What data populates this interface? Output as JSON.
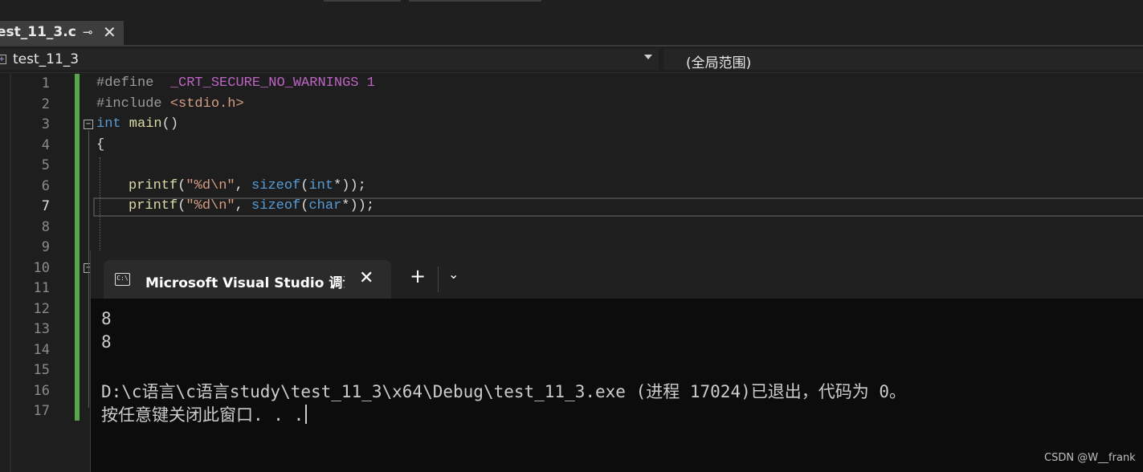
{
  "tab": {
    "file_name": "est_11_3.c",
    "pin_glyph": "⊸",
    "close_glyph": "✕"
  },
  "navbar": {
    "scope": "test_11_3",
    "global_scope": "(全局范围)"
  },
  "editor": {
    "line_numbers": [
      "1",
      "2",
      "3",
      "4",
      "5",
      "6",
      "7",
      "8",
      "9",
      "10",
      "11",
      "12",
      "13",
      "14",
      "15",
      "16",
      "17"
    ],
    "active_line": "7",
    "code": {
      "l1_pp": "#define  ",
      "l1_macro": "_CRT_SECURE_NO_WARNINGS",
      "l1_val": " 1",
      "l2_pp": "#include ",
      "l2_hdr": "<stdio.h>",
      "l3_kw": "int",
      "l3_fn": " main",
      "l3_rest": "()",
      "l4": "{",
      "l6_fn": "printf",
      "l6_a": "(",
      "l6_str": "\"%d\\n\"",
      "l6_b": ", ",
      "l6_kw1": "sizeof",
      "l6_c": "(",
      "l6_kw2": "int",
      "l6_d": "*));",
      "l7_fn": "printf",
      "l7_a": "(",
      "l7_str": "\"%d\\n\"",
      "l7_b": ", ",
      "l7_kw1": "sizeof",
      "l7_c": "(",
      "l7_kw2": "char",
      "l7_d": "*));"
    }
  },
  "console": {
    "tab_title": "Microsoft Visual Studio 调试控制台",
    "icon_text": "C:\\",
    "close_glyph": "✕",
    "new_tab_glyph": "+",
    "dropdown_glyph": "⌄",
    "output_lines": [
      "8",
      "8",
      "",
      "D:\\c语言\\c语言study\\test_11_3\\x64\\Debug\\test_11_3.exe (进程 17024)已退出，代码为 0。",
      "按任意键关闭此窗口. . ."
    ]
  },
  "watermark": "CSDN @W__frank",
  "colors": {
    "keyword": "#569cd6",
    "string": "#d69d85",
    "macro": "#bd63c5",
    "change_bar": "#57a64a"
  }
}
